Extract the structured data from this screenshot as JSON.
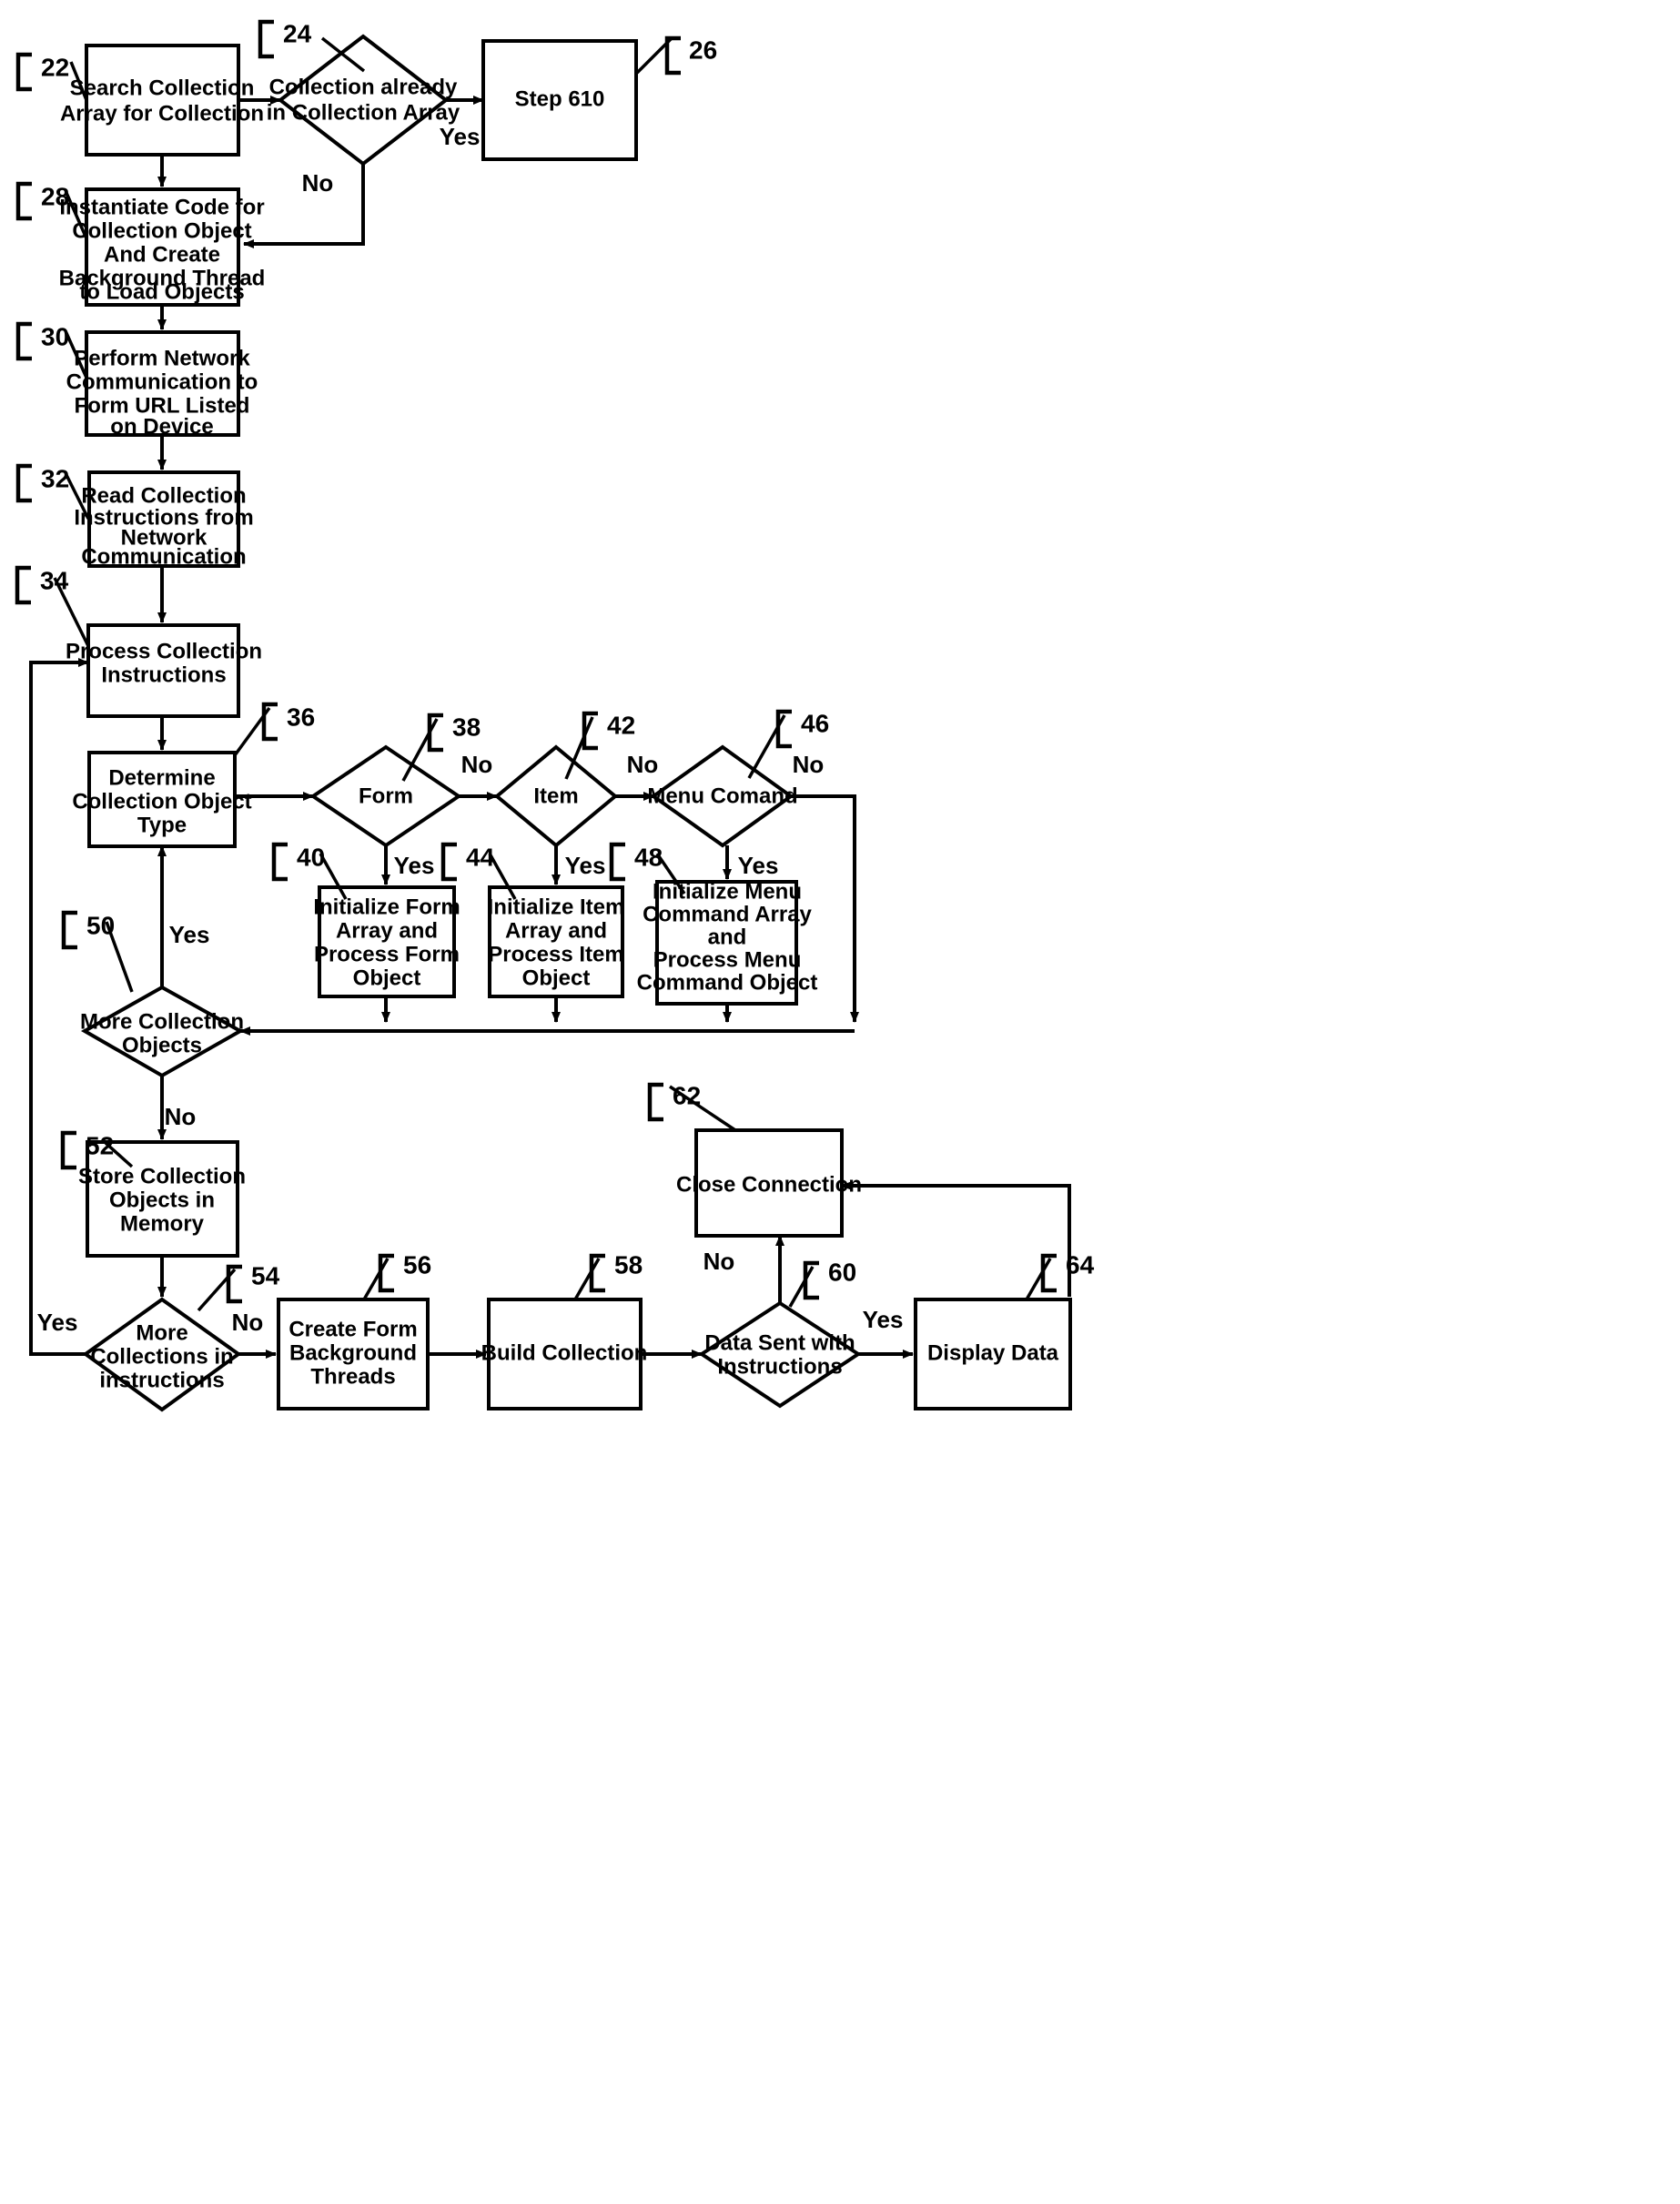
{
  "figure": {
    "type": "flowchart",
    "background_color": "#ffffff",
    "line_color": "#000000"
  },
  "nodes": [
    {
      "id": "n22",
      "ref": "22",
      "shape": "process",
      "lines": [
        "Search Collection",
        "Array for Collection"
      ]
    },
    {
      "id": "n24",
      "ref": "24",
      "shape": "decision",
      "lines": [
        "Collection already",
        "in Collection Array"
      ]
    },
    {
      "id": "n26",
      "ref": "26",
      "shape": "process",
      "lines": [
        "Step 610"
      ]
    },
    {
      "id": "n28",
      "ref": "28",
      "shape": "process",
      "lines": [
        "Instantiate Code for",
        "Collection Object",
        "And Create",
        "Background Thread",
        "to Load Objects"
      ]
    },
    {
      "id": "n30",
      "ref": "30",
      "shape": "process",
      "lines": [
        "Perform Network",
        "Communication to",
        "Form URL Listed",
        "on Device"
      ]
    },
    {
      "id": "n32",
      "ref": "32",
      "shape": "process",
      "lines": [
        "Read Collection",
        "Instructions from",
        "Network",
        "Communication"
      ]
    },
    {
      "id": "n34",
      "ref": "34",
      "shape": "process",
      "lines": [
        "Process Collection",
        "Instructions"
      ]
    },
    {
      "id": "n36",
      "ref": "36",
      "shape": "process",
      "lines": [
        "Determine",
        "Collection Object",
        "Type"
      ]
    },
    {
      "id": "n38",
      "ref": "38",
      "shape": "decision",
      "lines": [
        "Form"
      ]
    },
    {
      "id": "n40",
      "ref": "40",
      "shape": "process",
      "lines": [
        "Initialize Form",
        "Array and",
        "Process Form",
        "Object"
      ]
    },
    {
      "id": "n42",
      "ref": "42",
      "shape": "decision",
      "lines": [
        "Item"
      ]
    },
    {
      "id": "n44",
      "ref": "44",
      "shape": "process",
      "lines": [
        "Initialize Item",
        "Array and",
        "Process  Item",
        "Object"
      ]
    },
    {
      "id": "n46",
      "ref": "46",
      "shape": "decision",
      "lines": [
        "Menu Comand"
      ]
    },
    {
      "id": "n48",
      "ref": "48",
      "shape": "process",
      "lines": [
        "Initialize Menu",
        "Command Array",
        "and",
        "Process Menu",
        "Command Object"
      ]
    },
    {
      "id": "n50",
      "ref": "50",
      "shape": "decision",
      "lines": [
        "More Collection",
        "Objects"
      ]
    },
    {
      "id": "n52",
      "ref": "52",
      "shape": "process",
      "lines": [
        "Store Collection",
        "Objects in",
        "Memory"
      ]
    },
    {
      "id": "n54",
      "ref": "54",
      "shape": "decision",
      "lines": [
        "More",
        "Collections in",
        "instructions"
      ]
    },
    {
      "id": "n56",
      "ref": "56",
      "shape": "process",
      "lines": [
        "Create Form",
        "Background",
        "Threads"
      ]
    },
    {
      "id": "n58",
      "ref": "58",
      "shape": "process",
      "lines": [
        "Build Collection"
      ]
    },
    {
      "id": "n60",
      "ref": "60",
      "shape": "decision",
      "lines": [
        "Data Sent with",
        "Instructions"
      ]
    },
    {
      "id": "n62",
      "ref": "62",
      "shape": "process",
      "lines": [
        "Close Connection"
      ]
    },
    {
      "id": "n64",
      "ref": "64",
      "shape": "process",
      "lines": [
        "Display Data"
      ]
    }
  ],
  "edge_labels": [
    {
      "id": "e24yes",
      "text": "Yes",
      "from": "n24",
      "to": "n26"
    },
    {
      "id": "e24no",
      "text": "No",
      "from": "n24",
      "to": "n28"
    },
    {
      "id": "e38no",
      "text": "No",
      "from": "n38",
      "to": "n42"
    },
    {
      "id": "e38yes",
      "text": "Yes",
      "from": "n38",
      "to": "n40"
    },
    {
      "id": "e42no",
      "text": "No",
      "from": "n42",
      "to": "n46"
    },
    {
      "id": "e42yes",
      "text": "Yes",
      "from": "n42",
      "to": "n44"
    },
    {
      "id": "e46no",
      "text": "No",
      "from": "n46",
      "to": "n50"
    },
    {
      "id": "e46yes",
      "text": "Yes",
      "from": "n46",
      "to": "n48"
    },
    {
      "id": "e50yes",
      "text": "Yes",
      "from": "n50",
      "to": "n36"
    },
    {
      "id": "e50no",
      "text": "No",
      "from": "n50",
      "to": "n52"
    },
    {
      "id": "e54yes",
      "text": "Yes",
      "from": "n54",
      "to": "n34"
    },
    {
      "id": "e54no",
      "text": "No",
      "from": "n54",
      "to": "n56"
    },
    {
      "id": "e60no",
      "text": "No",
      "from": "n60",
      "to": "n62"
    },
    {
      "id": "e60yes",
      "text": "Yes",
      "from": "n60",
      "to": "n64"
    }
  ],
  "reference_numerals": [
    "22",
    "24",
    "26",
    "28",
    "30",
    "32",
    "34",
    "36",
    "38",
    "40",
    "42",
    "44",
    "46",
    "48",
    "50",
    "52",
    "54",
    "56",
    "58",
    "60",
    "62",
    "64"
  ]
}
